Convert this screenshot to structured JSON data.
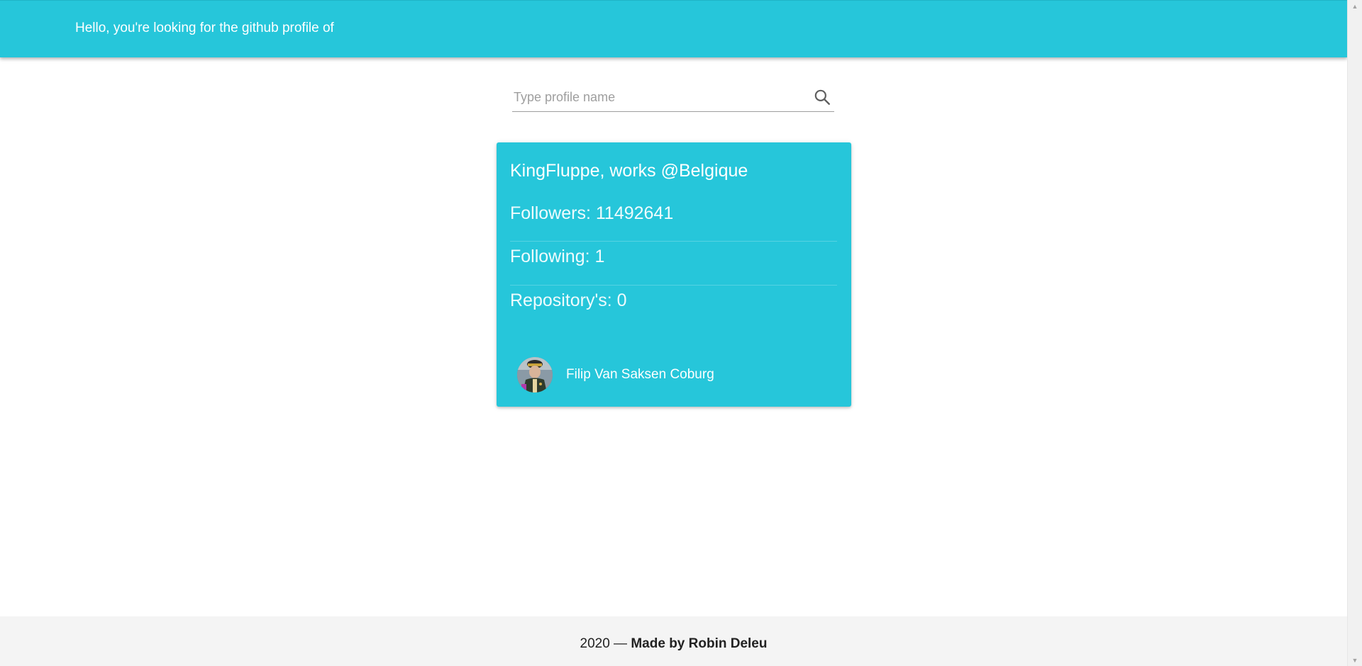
{
  "header": {
    "title": "Hello, you're looking for the github profile of"
  },
  "search": {
    "placeholder": "Type profile name",
    "value": "",
    "icon": "search-icon"
  },
  "profile": {
    "title": "KingFluppe, works @Belgique",
    "followers": "Followers: 11492641",
    "following": "Following: 1",
    "repositories": "Repository's: 0",
    "name": "Filip Van Saksen Coburg"
  },
  "footer": {
    "year": "2020 — ",
    "author": "Made by Robin Deleu"
  },
  "colors": {
    "accent": "#26c6da",
    "footer_bg": "#f4f4f4"
  }
}
